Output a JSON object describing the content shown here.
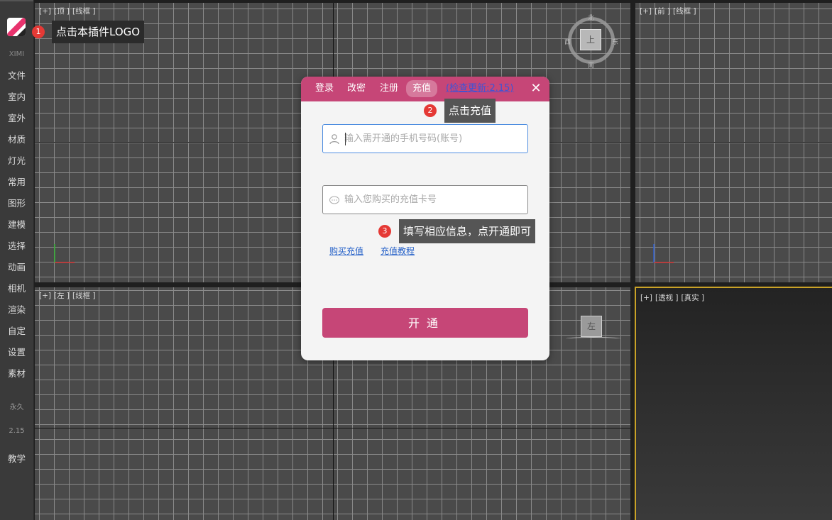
{
  "sidebar": {
    "brand": "XIMI",
    "items": [
      "文件",
      "室内",
      "室外",
      "材质",
      "灯光",
      "常用",
      "图形",
      "建模",
      "选择",
      "动画",
      "相机",
      "渲染",
      "自定",
      "设置",
      "素材"
    ],
    "license": "永久",
    "version": "2.15",
    "teach": "教学"
  },
  "viewports": {
    "top": {
      "plus": "[+]",
      "view": "[顶 ]",
      "mode": "[线框 ]"
    },
    "front": {
      "plus": "[+]",
      "view": "[前 ]",
      "mode": "[线框 ]"
    },
    "left": {
      "plus": "[+]",
      "view": "[左 ]",
      "mode": "[线框 ]"
    },
    "perspective": {
      "plus": "[+]",
      "view": "[透视 ]",
      "mode": "[真实 ]"
    }
  },
  "viewcube": {
    "top_face": "上",
    "north": "北",
    "south": "南",
    "west": "西",
    "east": "东",
    "left_face": "左"
  },
  "callouts": [
    {
      "num": "1",
      "text": "点击本插件LOGO"
    },
    {
      "num": "2",
      "text": "点击充值"
    },
    {
      "num": "3",
      "text": "填写相应信息，点开通即可"
    }
  ],
  "dialog": {
    "tabs": [
      "登录",
      "改密",
      "注册",
      "充值"
    ],
    "active_tab": "充值",
    "update_link": "(检查更新:2.15)",
    "close": "✕",
    "phone_placeholder": "输入需开通的手机号码(账号)",
    "card_placeholder": "输入您购买的充值卡号",
    "buy_link": "购买充值",
    "tutorial_link": "充值教程",
    "submit": "开通",
    "accent": "#c64677"
  }
}
